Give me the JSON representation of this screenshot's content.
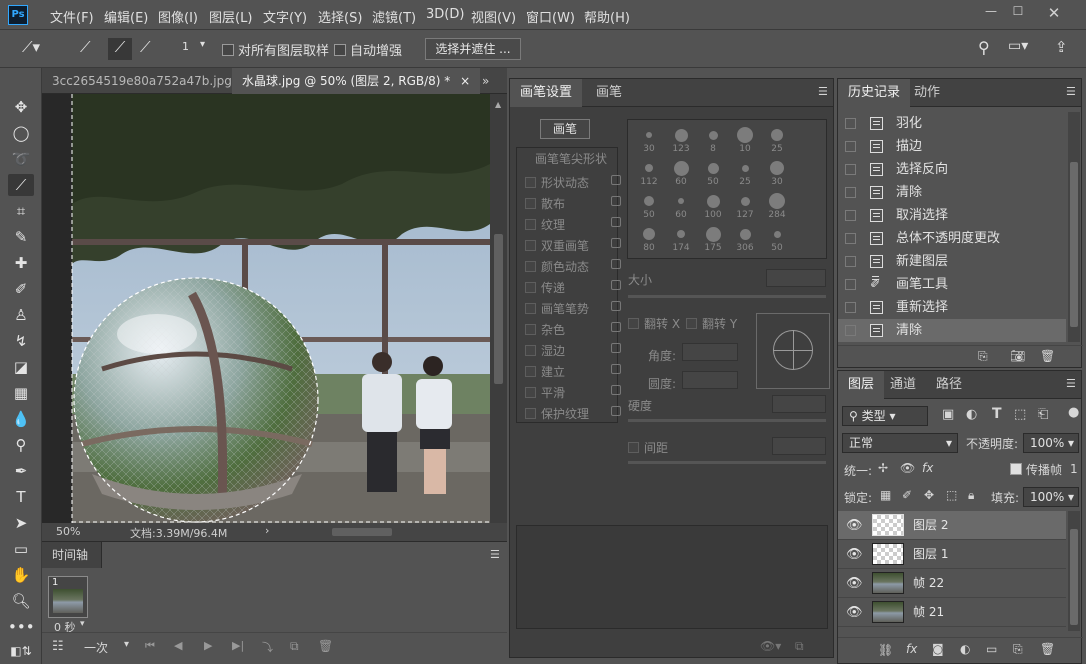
{
  "app": {
    "logo": "Ps"
  },
  "menu": [
    "文件(F)",
    "编辑(E)",
    "图像(I)",
    "图层(L)",
    "文字(Y)",
    "选择(S)",
    "滤镜(T)",
    "3D(D)",
    "视图(V)",
    "窗口(W)",
    "帮助(H)"
  ],
  "options": {
    "brush_size": "1",
    "sample_all_layers": "对所有图层取样",
    "auto_enhance": "自动增强",
    "refine_button": "选择并遮住 ..."
  },
  "tabs": {
    "inactive": "3cc2654519e80a752a47b.jpg",
    "active": "水晶球.jpg @ 50% (图层 2, RGB/8) *",
    "close": "×",
    "overflow": "»"
  },
  "status": {
    "zoom": "50%",
    "doc": "文档:3.39M/96.4M",
    "arrow": "›"
  },
  "timeline": {
    "title": "时间轴",
    "frame_number": "1",
    "frame_delay": "0 秒",
    "loop": "一次"
  },
  "brush_panel": {
    "tabs": [
      "画笔设置",
      "画笔"
    ],
    "brush_button": "画笔",
    "tip_shape": "画笔笔尖形状",
    "options": [
      "形状动态",
      "散布",
      "纹理",
      "双重画笔",
      "颜色动态",
      "传递",
      "画笔笔势",
      "杂色",
      "湿边",
      "建立",
      "平滑",
      "保护纹理"
    ],
    "preset_sizes": [
      "30",
      "123",
      "8",
      "10",
      "25",
      "112",
      "60",
      "50",
      "25",
      "30",
      "50",
      "60",
      "100",
      "127",
      "284",
      "80",
      "174",
      "175",
      "306",
      "50"
    ],
    "size_label": "大小",
    "flip_x": "翻转 X",
    "flip_y": "翻转 Y",
    "angle_label": "角度:",
    "roundness_label": "圆度:",
    "hardness_label": "硬度",
    "spacing_label": "间距"
  },
  "history": {
    "tabs": [
      "历史记录",
      "动作"
    ],
    "items": [
      "羽化",
      "描边",
      "选择反向",
      "清除",
      "取消选择",
      "总体不透明度更改",
      "新建图层",
      "画笔工具",
      "重新选择",
      "清除"
    ]
  },
  "layers": {
    "tabs": [
      "图层",
      "通道",
      "路径"
    ],
    "filter": "类型",
    "blend_mode": "正常",
    "opacity_label": "不透明度:",
    "opacity": "100%",
    "unify_label": "统一:",
    "propagate_label": "传播帧",
    "propagate_value": "1",
    "lock_label": "锁定:",
    "fill_label": "填充:",
    "fill": "100%",
    "items": [
      {
        "name": "图层 2",
        "kind": "transparent",
        "selected": true
      },
      {
        "name": "图层 1",
        "kind": "transparent",
        "selected": false
      },
      {
        "name": "帧 22",
        "kind": "photo",
        "selected": false
      },
      {
        "name": "帧 21",
        "kind": "photo",
        "selected": false
      }
    ]
  },
  "colors": {
    "accent": "#31a8ff",
    "panel": "#535353",
    "dark": "#3f3f3f"
  }
}
